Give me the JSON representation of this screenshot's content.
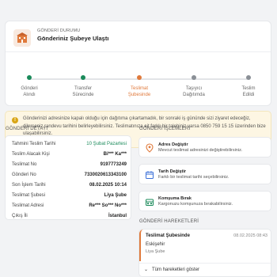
{
  "status": {
    "label": "GÖNDERİ DURUMU",
    "title": "Gönderiniz Şubeye Ulaştı",
    "steps": [
      {
        "label": "Gönderi",
        "label2": "Alındı",
        "state": "done"
      },
      {
        "label": "Transfer",
        "label2": "Sürecinde",
        "state": "done"
      },
      {
        "label": "Teslimat",
        "label2": "Şubesinde",
        "state": "active"
      },
      {
        "label": "Taşıyıcı",
        "label2": "Dağıtımda",
        "state": "pending"
      },
      {
        "label": "Teslim",
        "label2": "Edildi",
        "state": "pending"
      }
    ]
  },
  "notice": {
    "text": "Gönderinizi adresinize kapalı olduğu için dağıtıma çıkartamadık, bir sonraki iş gününde sizi ziyaret edeceğiz, dilerseniz randevu tarihini belirleyebilirsiniz. Teslimatınıza ait farklı bir talebiniz varsa 0850 759 15 15 üzerinden bize ulaşabilirsiniz."
  },
  "details": {
    "section_title": "GÖNDERİ DETAYI",
    "rows": [
      {
        "key": "Tahmini Teslim Tarihi",
        "value": "10 Şubat Pazartesi"
      },
      {
        "key": "Teslim Alacak Kişi",
        "value": "Bi*** Ka***"
      },
      {
        "key": "Teslimat No",
        "value": "9197773249"
      },
      {
        "key": "Gönderi No",
        "value": "733002061334310​0"
      },
      {
        "key": "Son İşlem Tarihi",
        "value": "08.02.2025 10:14"
      },
      {
        "key": "Teslimat Şubesi",
        "value": "Liya Şube"
      },
      {
        "key": "Teslimat Adresi",
        "value": "Re*** So*** No***"
      },
      {
        "key": "Çıkış İli",
        "value": "İstanbul"
      }
    ]
  },
  "actions": {
    "section_title": "GÖNDERİ İŞLEMLERİ",
    "items": [
      {
        "title": "Adres Değiştir",
        "desc": "Mevcut teslimat adresinizi değiştirebilirsiniz.",
        "icon": "location-pin-icon"
      },
      {
        "title": "Tarih Değiştir",
        "desc": "Farklı bir teslimat tarihi seçebilirsiniz.",
        "icon": "calendar-icon"
      },
      {
        "title": "Komşuma Bırak",
        "desc": "Kargonuzu komşunuza bırakabilirsiniz.",
        "icon": "neighbor-icon"
      }
    ]
  },
  "history": {
    "section_title": "GÖNDERİ HAREKETLERİ",
    "latest": {
      "title": "Teslimat Şubesinde",
      "time": "08.02.2025 08:43",
      "city": "Eskişehir",
      "branch": "Liya Şube"
    },
    "more_label": "Tüm hareketleri göster"
  },
  "colors": {
    "accent": "#e07a3c",
    "success": "#1a8a5a",
    "warning": "#d9a515"
  }
}
